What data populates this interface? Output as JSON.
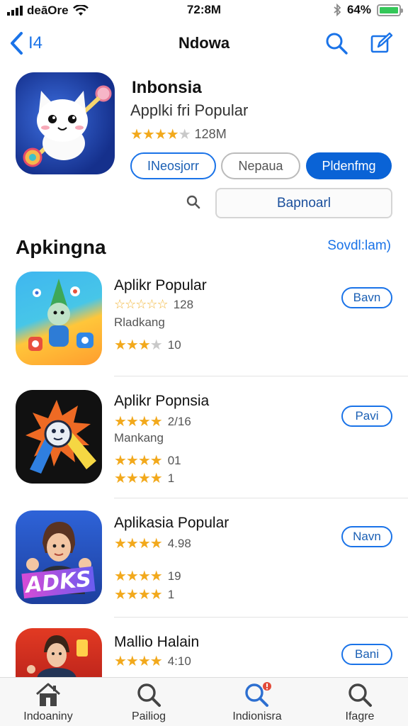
{
  "status": {
    "carrier": "deāOre",
    "time": "72:8M",
    "battery": "64%"
  },
  "nav": {
    "back_label": "I4",
    "title": "Ndowa"
  },
  "featured": {
    "title": "Inbonsia",
    "subtitle": "Applki fri Popular",
    "rating_count": "128M",
    "rating_stars": 4,
    "buttons": [
      "INeosjorr",
      "Nepaua",
      "Pldenfmg"
    ],
    "search_value": "Bapnoarl"
  },
  "section": {
    "title": "Apkingna",
    "see_all": "Sovdl:lam)"
  },
  "apps": [
    {
      "name": "Aplikr Popular",
      "line1": "128",
      "label": "Rladkang",
      "line2": "10",
      "action": "Bavn"
    },
    {
      "name": "Aplikr Popnsia",
      "line1": "2/16",
      "label": "Mankang",
      "line2": "01",
      "line3": "1",
      "action": "Pavi"
    },
    {
      "name": "Aplikasia Popular",
      "line1": "4.98",
      "line2": "19",
      "line3": "1",
      "action": "Navn",
      "icon_text": "ADKS"
    },
    {
      "name": "Mallio Halain",
      "line1": "4:10",
      "action": "Bani"
    }
  ],
  "tabs": [
    "Indoaniny",
    "Pailiog",
    "Indionisra",
    "Ifagre"
  ],
  "colors": {
    "accent": "#1a73e8",
    "star": "#f2a91c",
    "battery": "#34c759"
  }
}
